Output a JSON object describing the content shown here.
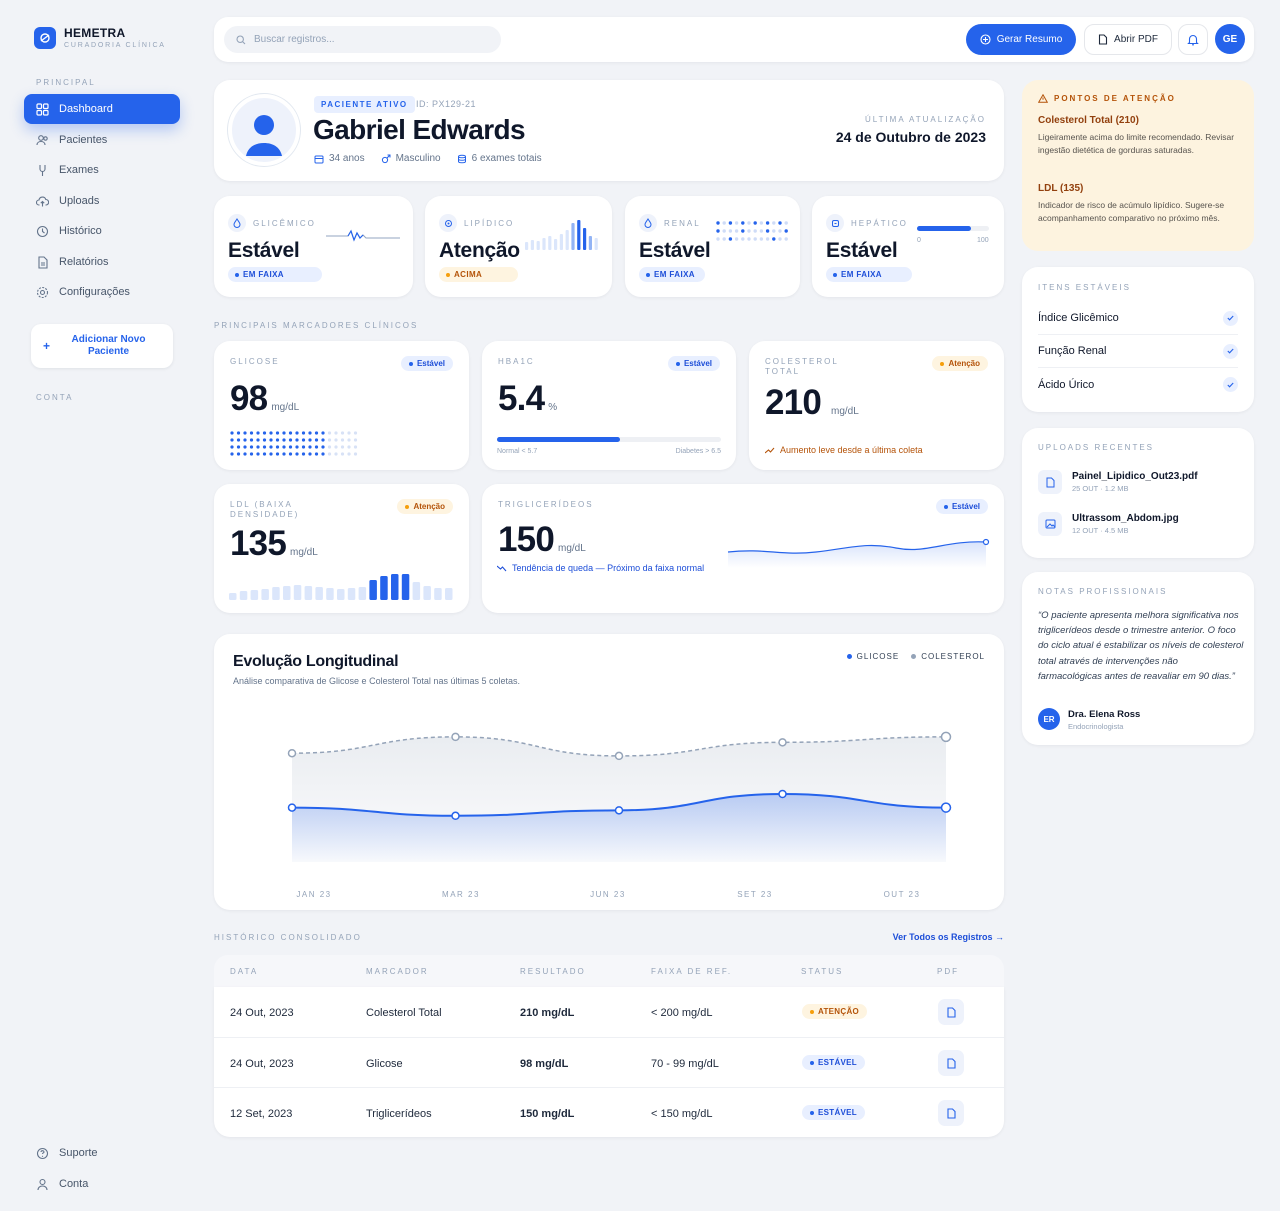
{
  "brand": {
    "name": "HEMETRA",
    "subtitle": "CURADORIA CLÍNICA"
  },
  "sidebar": {
    "section_main": "PRINCIPAL",
    "items": [
      {
        "label": "Dashboard",
        "icon": "grid-icon",
        "active": true
      },
      {
        "label": "Pacientes",
        "icon": "users-icon"
      },
      {
        "label": "Exames",
        "icon": "stethoscope-icon"
      },
      {
        "label": "Uploads",
        "icon": "cloud-upload-icon"
      },
      {
        "label": "Histórico",
        "icon": "history-icon"
      },
      {
        "label": "Relatórios",
        "icon": "document-icon"
      },
      {
        "label": "Configurações",
        "icon": "gear-icon"
      }
    ],
    "add_patient": "Adicionar Novo Paciente",
    "section_account": "CONTA",
    "footer": [
      {
        "label": "Suporte",
        "icon": "help-icon"
      },
      {
        "label": "Conta",
        "icon": "user-icon"
      }
    ]
  },
  "topbar": {
    "search_placeholder": "Buscar registros...",
    "summary_button": "Gerar Resumo",
    "pdf_button": "Abrir PDF",
    "avatar_initials": "GE"
  },
  "patient": {
    "badge": "PACIENTE ATIVO",
    "id": "ID: PX129-21",
    "name": "Gabriel Edwards",
    "age": "34 anos",
    "sex": "Masculino",
    "exams": "6 exames totais",
    "update_label": "ÚLTIMA ATUALIZAÇÃO",
    "update_value": "24 de Outubro de 2023"
  },
  "status_cards": [
    {
      "label": "GLICÊMICO",
      "state": "Estável",
      "badge": "EM FAIXA",
      "tone": "blue"
    },
    {
      "label": "LIPÍDICO",
      "state": "Atenção",
      "badge": "ACIMA",
      "tone": "amber"
    },
    {
      "label": "RENAL",
      "state": "Estável",
      "badge": "EM FAIXA",
      "tone": "blue"
    },
    {
      "label": "HEPÁTICO",
      "state": "Estável",
      "badge": "EM FAIXA",
      "tone": "blue",
      "gauge_min": "0",
      "gauge_max": "100",
      "gauge_level": 0.75
    }
  ],
  "markers_title": "PRINCIPAIS MARCADORES CLÍNICOS",
  "markers": {
    "glucose": {
      "label": "GLICOSE",
      "value": "98",
      "unit": "mg/dL",
      "tag": "Estável"
    },
    "hba1c": {
      "label": "HBA1C",
      "value": "5.4",
      "unit": "%",
      "tag": "Estável",
      "range_low": "Normal < 5.7",
      "range_high": "Diabetes > 6.5",
      "level": 0.55
    },
    "cholesterol": {
      "label": "COLESTEROL TOTAL",
      "value": "210",
      "unit": "mg/dL",
      "tag": "Atenção",
      "note": "Aumento leve desde a última coleta"
    },
    "ldl": {
      "label": "LDL (BAIXA DENSIDADE)",
      "value": "135",
      "unit": "mg/dL",
      "tag": "Atenção"
    },
    "trig": {
      "label": "TRIGLICERÍDEOS",
      "value": "150",
      "unit": "mg/dL",
      "tag": "Estável",
      "note": "Tendência de queda — Próximo da faixa normal"
    }
  },
  "evolution": {
    "title": "Evolução Longitudinal",
    "subtitle": "Análise comparativa de Glicose e Colesterol Total nas últimas 5 coletas."
  },
  "chart_data": {
    "type": "area",
    "categories": [
      "JAN 23",
      "MAR 23",
      "JUN 23",
      "SET 23",
      "OUT 23"
    ],
    "series": [
      {
        "name": "GLICOSE",
        "color": "#2563eb",
        "values": [
          0.4,
          0.34,
          0.38,
          0.5,
          0.4
        ]
      },
      {
        "name": "COLESTEROL",
        "color": "#94a3b8",
        "values": [
          0.8,
          0.92,
          0.78,
          0.88,
          0.92
        ]
      }
    ],
    "ylim": [
      0,
      1
    ],
    "grid": false,
    "legend": "top-right"
  },
  "history": {
    "title": "HISTÓRICO CONSOLIDADO",
    "view_all": "Ver Todos os Registros →",
    "columns": [
      "DATA",
      "MARCADOR",
      "RESULTADO",
      "FAIXA DE REF.",
      "STATUS",
      "PDF"
    ],
    "rows": [
      {
        "date": "24 Out, 2023",
        "marker": "Colesterol Total",
        "result": "210 mg/dL",
        "range": "< 200 mg/dL",
        "status": "ATENÇÃO",
        "tone": "amber"
      },
      {
        "date": "24 Out, 2023",
        "marker": "Glicose",
        "result": "98 mg/dL",
        "range": "70 - 99 mg/dL",
        "status": "ESTÁVEL",
        "tone": "blue"
      },
      {
        "date": "12 Set, 2023",
        "marker": "Triglicerídeos",
        "result": "150 mg/dL",
        "range": "< 150 mg/dL",
        "status": "ESTÁVEL",
        "tone": "blue"
      }
    ]
  },
  "attention": {
    "title": "PONTOS DE ATENÇÃO",
    "items": [
      {
        "heading": "Colesterol Total (210)",
        "text": "Ligeiramente acima do limite recomendado. Revisar ingestão dietética de gorduras saturadas."
      },
      {
        "heading": "LDL (135)",
        "text": "Indicador de risco de acúmulo lipídico. Sugere-se acompanhamento comparativo no próximo mês."
      }
    ]
  },
  "stable_items": {
    "title": "ITENS ESTÁVEIS",
    "items": [
      "Índice Glicêmico",
      "Função Renal",
      "Ácido Úrico"
    ]
  },
  "uploads": {
    "title": "UPLOADS RECENTES",
    "files": [
      {
        "name": "Painel_Lipidico_Out23.pdf",
        "meta": "25 OUT · 1.2 MB",
        "icon": "file-icon"
      },
      {
        "name": "Ultrassom_Abdom.jpg",
        "meta": "12 OUT · 4.5 MB",
        "icon": "image-icon"
      }
    ]
  },
  "notes": {
    "title": "NOTAS PROFISSIONAIS",
    "quote": "“O paciente apresenta melhora significativa nos triglicerídeos desde o trimestre anterior. O foco do ciclo atual é estabilizar os níveis de colesterol total através de intervenções não farmacológicas antes de reavaliar em 90 dias.”",
    "doctor_initials": "ER",
    "doctor_name": "Dra. Elena Ross",
    "doctor_role": "Endocrinologista"
  }
}
